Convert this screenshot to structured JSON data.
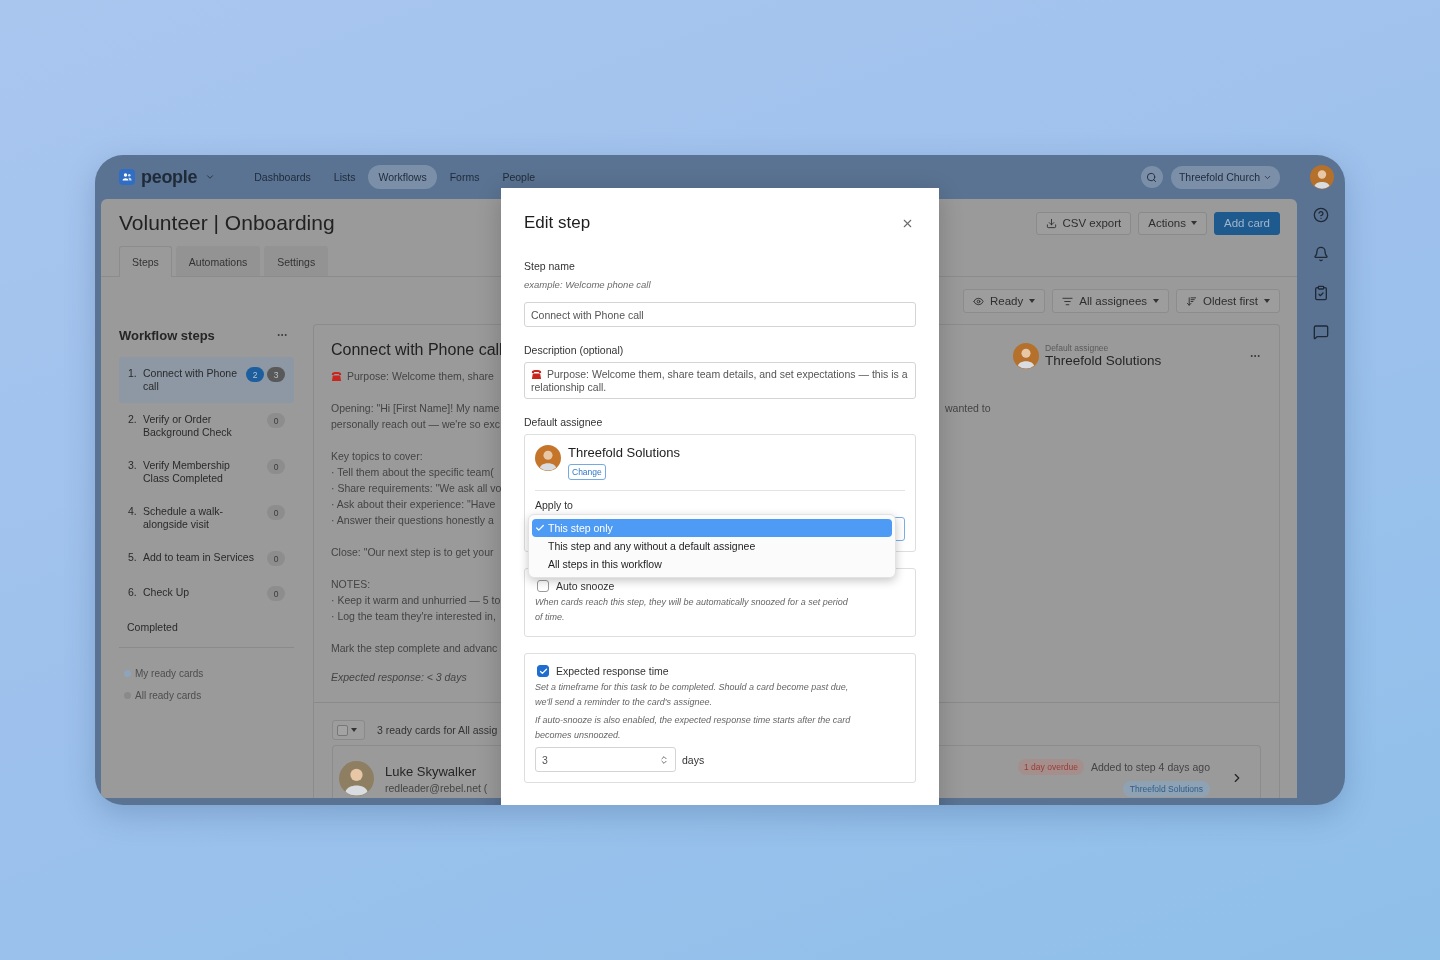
{
  "nav": {
    "logo": "people",
    "links": [
      {
        "label": "Dashboards",
        "selected": false
      },
      {
        "label": "Lists",
        "selected": false
      },
      {
        "label": "Workflows",
        "selected": true
      },
      {
        "label": "Forms",
        "selected": false
      },
      {
        "label": "People",
        "selected": false
      }
    ],
    "organization": "Threefold Church"
  },
  "page": {
    "title": "Volunteer | Onboarding",
    "buttons": [
      {
        "label": "CSV export",
        "kind": "export"
      },
      {
        "label": "Actions",
        "kind": "menu"
      },
      {
        "label": "Add card",
        "kind": "primary"
      }
    ],
    "tabs": [
      {
        "label": "Steps",
        "selected": true
      },
      {
        "label": "Automations",
        "selected": false
      },
      {
        "label": "Settings",
        "selected": false
      }
    ],
    "filters": [
      {
        "label": "Ready",
        "kind": "visibility"
      },
      {
        "label": "All assignees",
        "kind": "assignee"
      },
      {
        "label": "Oldest first",
        "kind": "sort"
      }
    ]
  },
  "sidebar": {
    "title": "Workflow steps",
    "steps": [
      {
        "number": "1.",
        "label": "Connect with Phone call",
        "selected": true,
        "badges": [
          {
            "count": "2",
            "kind": "mine"
          },
          {
            "count": "3",
            "kind": "total"
          }
        ]
      },
      {
        "number": "2.",
        "label": "Verify or Order Background Check",
        "selected": false,
        "badges": [
          {
            "count": "0",
            "kind": "empty"
          }
        ]
      },
      {
        "number": "3.",
        "label": "Verify Membership Class Completed",
        "selected": false,
        "badges": [
          {
            "count": "0",
            "kind": "empty"
          }
        ]
      },
      {
        "number": "4.",
        "label": "Schedule a walk-alongside visit",
        "selected": false,
        "badges": [
          {
            "count": "0",
            "kind": "empty"
          }
        ]
      },
      {
        "number": "5.",
        "label": "Add to team in Services",
        "selected": false,
        "badges": [
          {
            "count": "0",
            "kind": "empty"
          }
        ]
      },
      {
        "number": "6.",
        "label": "Check Up",
        "selected": false,
        "badges": [
          {
            "count": "0",
            "kind": "empty"
          }
        ]
      }
    ],
    "completed": "Completed",
    "legend": [
      {
        "label": "My ready cards",
        "color": "#8ea4bb"
      },
      {
        "label": "All ready cards",
        "color": "#8a8a8a"
      }
    ]
  },
  "step_card": {
    "title": "Connect with Phone call",
    "assignee_caption": "Default assignee",
    "assignee": "Threefold Solutions",
    "paragraphs": [
      {
        "kind": "purpose",
        "lines": [
          "Purpose: Welcome them, share"
        ]
      },
      {
        "kind": "text",
        "lines": [
          "Opening: \"Hi [First Name]! My name",
          "personally reach out — we're so exc"
        ]
      },
      {
        "kind": "text",
        "lines": [
          "Key topics to cover:",
          "· Tell them about the specific team(",
          "· Share requirements: \"We ask all vo",
          "· Ask about their experience: \"Have",
          "· Answer their questions honestly a"
        ]
      },
      {
        "kind": "text",
        "lines": [
          "Close: \"Our next step is to get your"
        ]
      },
      {
        "kind": "text",
        "lines": [
          "NOTES:",
          "· Keep it warm and unhurried — 5 to",
          "· Log the team they're interested in,"
        ]
      },
      {
        "kind": "text",
        "lines": [
          "Mark the step complete and advanc"
        ]
      },
      {
        "kind": "italic",
        "lines": [
          "Expected response: < 3 days"
        ]
      }
    ],
    "continued_text": "wanted to",
    "select_all": {
      "checked": false
    },
    "summary": "3 ready cards for All assig",
    "cards": [
      {
        "name": "Luke Skywalker",
        "email": "redleader@rebel.net",
        "phone": "(",
        "overdue": "1 day overdue",
        "added": "Added to step 4 days ago",
        "assignee": "Threefold Solutions"
      }
    ]
  },
  "modal": {
    "title": "Edit step",
    "step_name": {
      "label": "Step name",
      "hint": "example: Welcome phone call",
      "value": "Connect with Phone call"
    },
    "description": {
      "label": "Description (optional)",
      "value": "Purpose: Welcome them, share team details, and set expectations — this is a relationship call."
    },
    "assignee": {
      "label": "Default assignee",
      "name": "Threefold Solutions",
      "change": "Change",
      "apply_label": "Apply to",
      "options": [
        {
          "label": "This step only",
          "selected": true
        },
        {
          "label": "This step and any without a default assignee",
          "selected": false
        },
        {
          "label": "All steps in this workflow",
          "selected": false
        }
      ]
    },
    "auto_snooze": {
      "label": "Auto snooze",
      "checked": false,
      "help": [
        "When cards reach this step, they will be automatically snoozed for a set period of time."
      ]
    },
    "response_time": {
      "label": "Expected response time",
      "checked": true,
      "help": [
        "Set a timeframe for this task to be completed. Should a card become past due, we'll send a reminder to the card's assignee.",
        "If auto-snooze is also enabled, the expected response time starts after the card becomes unsnoozed."
      ],
      "value": "3",
      "unit": "days"
    }
  }
}
